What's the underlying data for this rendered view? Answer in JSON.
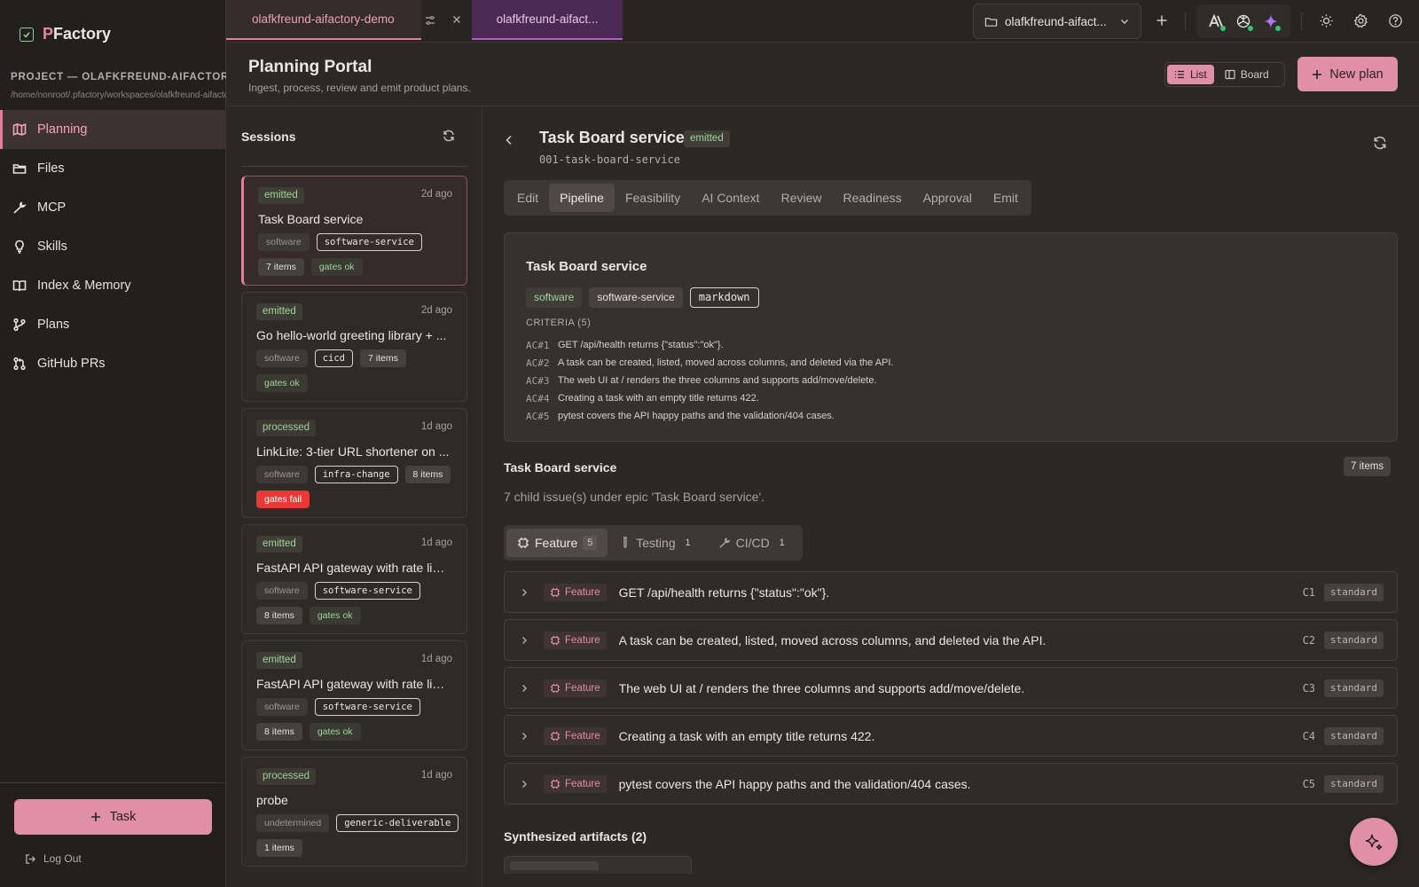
{
  "app": {
    "brand_prefix": "P",
    "brand_rest": "Factory"
  },
  "project": {
    "label": "PROJECT — OLAFKFREUND-AIFACTORY-DEMO",
    "path": "/home/nonroot/.pfactory/workspaces/olafkfreund-aifactory-demo"
  },
  "nav": [
    {
      "label": "Planning",
      "icon": "map-icon",
      "active": true
    },
    {
      "label": "Files",
      "icon": "folder-icon",
      "active": false
    },
    {
      "label": "MCP",
      "icon": "wrench-icon",
      "active": false
    },
    {
      "label": "Skills",
      "icon": "lightbulb-icon",
      "active": false
    },
    {
      "label": "Index & Memory",
      "icon": "book-icon",
      "active": false
    },
    {
      "label": "Plans",
      "icon": "git-branch-icon",
      "active": false
    },
    {
      "label": "GitHub PRs",
      "icon": "git-pull-request-icon",
      "active": false
    }
  ],
  "footer": {
    "task_label": "Task",
    "logout_label": "Log Out"
  },
  "tabs": [
    {
      "label": "olafkfreund-aifactory-demo"
    },
    {
      "label": "olafkfreund-aifact..."
    }
  ],
  "workspace_select": {
    "value": "olafkfreund-aifact..."
  },
  "header": {
    "title": "Planning Portal",
    "subtitle": "Ingest, process, review and emit product plans.",
    "view_list": "List",
    "view_board": "Board",
    "new_plan": "New plan"
  },
  "sessions": {
    "title": "Sessions",
    "items": [
      {
        "status": "emitted",
        "age": "2d ago",
        "title": "Task Board service",
        "chips": [
          {
            "t": "software",
            "k": "kind"
          },
          {
            "t": "software-service",
            "k": "tag"
          },
          {
            "t": "7 items",
            "k": "items"
          },
          {
            "t": "gates ok",
            "k": "ok"
          }
        ]
      },
      {
        "status": "emitted",
        "age": "2d ago",
        "title": "Go hello-world greeting library + ...",
        "chips": [
          {
            "t": "software",
            "k": "kind"
          },
          {
            "t": "cicd",
            "k": "tag"
          },
          {
            "t": "7 items",
            "k": "items"
          },
          {
            "t": "gates ok",
            "k": "ok"
          }
        ]
      },
      {
        "status": "processed",
        "age": "1d ago",
        "title": "LinkLite: 3-tier URL shortener on ...",
        "chips": [
          {
            "t": "software",
            "k": "kind"
          },
          {
            "t": "infra-change",
            "k": "tag"
          },
          {
            "t": "8 items",
            "k": "items"
          },
          {
            "t": "gates fail",
            "k": "fail"
          }
        ]
      },
      {
        "status": "emitted",
        "age": "1d ago",
        "title": "FastAPI API gateway with rate lim...",
        "chips": [
          {
            "t": "software",
            "k": "kind"
          },
          {
            "t": "software-service",
            "k": "tag"
          },
          {
            "t": "8 items",
            "k": "items"
          },
          {
            "t": "gates ok",
            "k": "ok"
          }
        ]
      },
      {
        "status": "emitted",
        "age": "1d ago",
        "title": "FastAPI API gateway with rate lim...",
        "chips": [
          {
            "t": "software",
            "k": "kind"
          },
          {
            "t": "software-service",
            "k": "tag"
          },
          {
            "t": "8 items",
            "k": "items"
          },
          {
            "t": "gates ok",
            "k": "ok"
          }
        ]
      },
      {
        "status": "processed",
        "age": "1d ago",
        "title": "probe",
        "chips": [
          {
            "t": "undetermined",
            "k": "kind"
          },
          {
            "t": "generic-deliverable",
            "k": "tag"
          },
          {
            "t": "1 items",
            "k": "items"
          }
        ]
      }
    ]
  },
  "plan": {
    "title": "Task Board service",
    "status": "emitted",
    "slug": "001-task-board-service",
    "tabs": [
      "Edit",
      "Pipeline",
      "Feasibility",
      "AI Context",
      "Review",
      "Readiness",
      "Approval",
      "Emit"
    ],
    "active_tab": "Pipeline",
    "summary": {
      "title": "Task Board service",
      "chips": [
        "software",
        "software-service",
        "markdown"
      ],
      "criteria_label": "CRITERIA (5)",
      "criteria": [
        {
          "id": "AC#1",
          "text": "GET /api/health returns {\"status\":\"ok\"}."
        },
        {
          "id": "AC#2",
          "text": "A task can be created, listed, moved across columns, and deleted via the API."
        },
        {
          "id": "AC#3",
          "text": "The web UI at / renders the three columns and supports add/move/delete."
        },
        {
          "id": "AC#4",
          "text": "Creating a task with an empty title returns 422."
        },
        {
          "id": "AC#5",
          "text": "pytest covers the API happy paths and the validation/404 cases."
        }
      ]
    },
    "epic": {
      "title": "Task Board service",
      "count": "7 items",
      "description": "7 child issue(s) under epic 'Task Board service'."
    },
    "type_tabs": [
      {
        "label": "Feature",
        "count": "5"
      },
      {
        "label": "Testing",
        "count": "1"
      },
      {
        "label": "CI/CD",
        "count": "1"
      }
    ],
    "issues": [
      {
        "type": "Feature",
        "text": "GET /api/health returns {\"status\":\"ok\"}.",
        "code": "C1",
        "level": "standard"
      },
      {
        "type": "Feature",
        "text": "A task can be created, listed, moved across columns, and deleted via the API.",
        "code": "C2",
        "level": "standard"
      },
      {
        "type": "Feature",
        "text": "The web UI at / renders the three columns and supports add/move/delete.",
        "code": "C3",
        "level": "standard"
      },
      {
        "type": "Feature",
        "text": "Creating a task with an empty title returns 422.",
        "code": "C4",
        "level": "standard"
      },
      {
        "type": "Feature",
        "text": "pytest covers the API happy paths and the validation/404 cases.",
        "code": "C5",
        "level": "standard"
      }
    ],
    "artifacts_title": "Synthesized artifacts (2)"
  },
  "colors": {
    "accent": "#e08fa8",
    "ok": "#9fd39a",
    "fail": "#e53a35",
    "tab2": "#4a2a52"
  }
}
